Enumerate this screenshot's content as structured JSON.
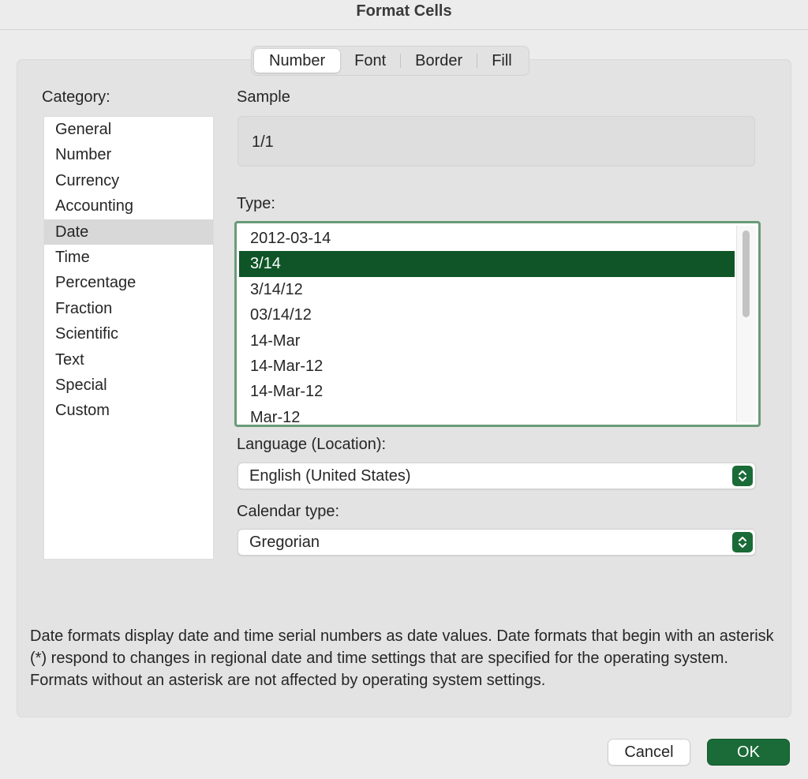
{
  "window": {
    "title": "Format Cells"
  },
  "tabs": [
    {
      "label": "Number",
      "active": true
    },
    {
      "label": "Font",
      "active": false
    },
    {
      "label": "Border",
      "active": false
    },
    {
      "label": "Fill",
      "active": false
    }
  ],
  "category": {
    "label": "Category:",
    "items": [
      "General",
      "Number",
      "Currency",
      "Accounting",
      "Date",
      "Time",
      "Percentage",
      "Fraction",
      "Scientific",
      "Text",
      "Special",
      "Custom"
    ],
    "selected": "Date"
  },
  "sample": {
    "label": "Sample",
    "value": "1/1"
  },
  "type": {
    "label": "Type:",
    "items": [
      "2012-03-14",
      "3/14",
      "3/14/12",
      "03/14/12",
      "14-Mar",
      "14-Mar-12",
      "14-Mar-12",
      "Mar-12"
    ],
    "selected_index": 1
  },
  "language": {
    "label": "Language (Location):",
    "value": "English (United States)"
  },
  "calendar": {
    "label": "Calendar type:",
    "value": "Gregorian"
  },
  "description": "Date formats display date and time serial numbers as date values.  Date formats that begin with an asterisk (*) respond to changes in regional date and time settings that are specified for the operating system. Formats without an asterisk are not affected by operating system settings.",
  "buttons": {
    "cancel": "Cancel",
    "ok": "OK"
  },
  "colors": {
    "accent": "#1a6b37",
    "selection": "#0f5527",
    "focus_ring": "#6a9a78"
  },
  "icons": {
    "stepper": "chevron-up-down-icon"
  }
}
